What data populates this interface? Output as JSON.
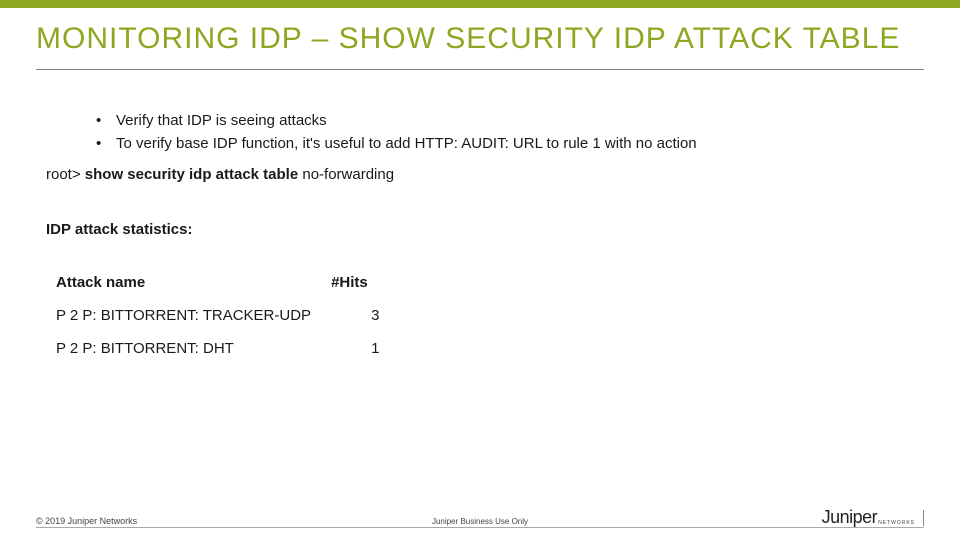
{
  "header": {
    "title": "MONITORING IDP – SHOW SECURITY IDP ATTACK TABLE"
  },
  "bullets": [
    "Verify that IDP is seeing attacks",
    "To verify base IDP function, it's useful to add HTTP: AUDIT: URL to rule 1 with no action"
  ],
  "command": {
    "prompt": "root> ",
    "bold": "show security idp attack table",
    "suffix": " no-forwarding"
  },
  "stats_title": "IDP attack statistics:",
  "table": {
    "headers": {
      "name": "Attack name",
      "hits": "#Hits"
    },
    "rows": [
      {
        "name": "P 2 P: BITTORRENT: TRACKER-UDP",
        "hits": "3"
      },
      {
        "name": "P 2 P: BITTORRENT: DHT",
        "hits": "1"
      }
    ]
  },
  "footer": {
    "copyright": "© 2019 Juniper Networks",
    "classification": "Juniper Business Use Only",
    "logo_text": "Juniper",
    "logo_sub": "NETWORKS"
  }
}
